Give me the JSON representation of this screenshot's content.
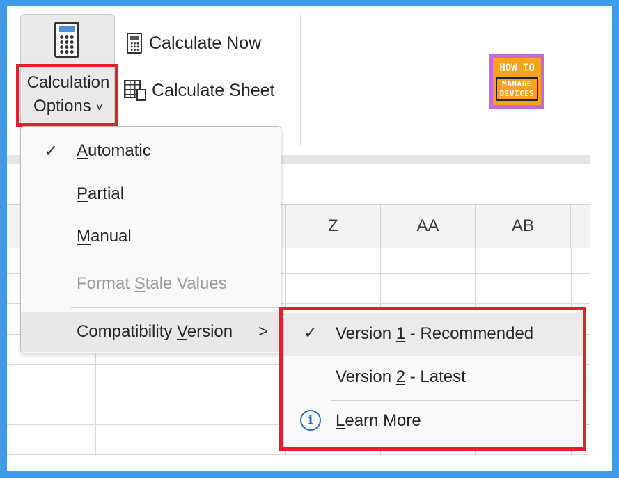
{
  "ribbon": {
    "calc_options": {
      "line1": "Calculation",
      "line2": "Options",
      "chevron": "˅",
      "icon": "calculator-icon"
    },
    "calculate_now": {
      "label": "Calculate Now",
      "icon": "calculator-small-icon"
    },
    "calculate_sheet": {
      "label": "Calculate Sheet",
      "icon": "sheet-calculator-icon"
    }
  },
  "logo": {
    "line1": "HOW TO",
    "line2": "MANAGE",
    "line3": "DEVICES"
  },
  "grid": {
    "columns": [
      "Z",
      "AA",
      "AB"
    ]
  },
  "menu": {
    "items": [
      {
        "pre": "",
        "u": "A",
        "post": "utomatic",
        "checked": true
      },
      {
        "pre": "",
        "u": "P",
        "post": "artial",
        "checked": false
      },
      {
        "pre": "",
        "u": "M",
        "post": "anual",
        "checked": false
      },
      {
        "pre": "Format ",
        "u": "S",
        "post": "tale Values",
        "disabled": true
      },
      {
        "pre": "Compatibility ",
        "u": "V",
        "post": "ersion",
        "has_submenu": true
      }
    ],
    "check_glyph": "✓",
    "submenu_chevron": ">"
  },
  "submenu": {
    "items": [
      {
        "pre": "Version ",
        "u": "1",
        "post": " - Recommended",
        "checked": true
      },
      {
        "pre": "Version ",
        "u": "2",
        "post": " - Latest",
        "checked": false
      },
      {
        "pre": "",
        "u": "L",
        "post": "earn More",
        "icon": "info-icon"
      }
    ],
    "info_glyph": "i"
  },
  "colors": {
    "highlight": "#e3202f",
    "frame": "#3d9be9",
    "accent": "#2c6fc2"
  }
}
